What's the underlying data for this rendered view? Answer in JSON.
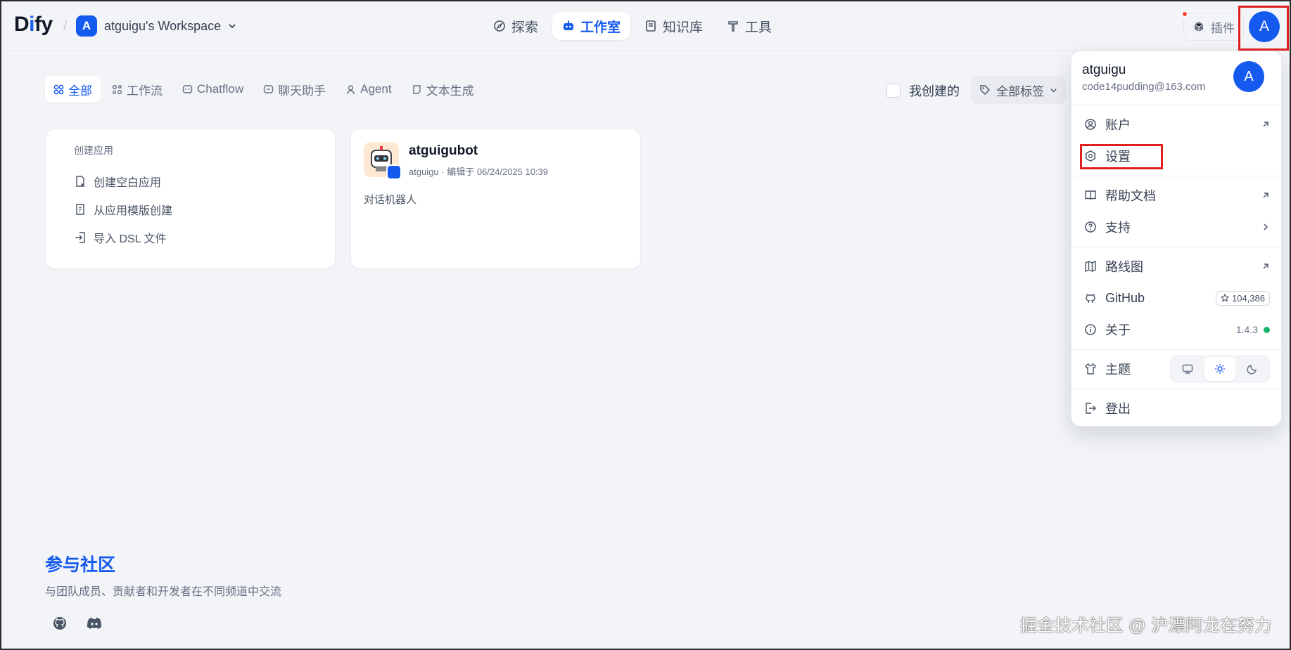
{
  "header": {
    "logo": {
      "d": "D",
      "i": "i",
      "fy": "fy"
    },
    "workspace": {
      "avatar": "A",
      "name": "atguigu's Workspace"
    },
    "nav": [
      {
        "label": "探索",
        "icon": "compass-icon"
      },
      {
        "label": "工作室",
        "icon": "robot-icon",
        "active": true
      },
      {
        "label": "知识库",
        "icon": "book-icon"
      },
      {
        "label": "工具",
        "icon": "hammer-icon"
      }
    ],
    "plugin_label": "插件",
    "user_avatar": "A"
  },
  "filters": {
    "tabs": [
      {
        "label": "全部",
        "active": true
      },
      {
        "label": "工作流"
      },
      {
        "label": "Chatflow"
      },
      {
        "label": "聊天助手"
      },
      {
        "label": "Agent"
      },
      {
        "label": "文本生成"
      }
    ],
    "mine_label": "我创建的",
    "tags_label": "全部标签"
  },
  "create_card": {
    "title": "创建应用",
    "items": [
      "创建空白应用",
      "从应用模版创建",
      "导入 DSL 文件"
    ]
  },
  "app_card": {
    "name": "atguigubot",
    "meta": "atguigu · 编辑于 06/24/2025 10:39",
    "description": "对话机器人"
  },
  "community": {
    "title": "参与社区",
    "subtitle": "与团队成员、贡献者和开发者在不同频道中交流"
  },
  "watermark": "掘金技术社区 @ 沪漂阿龙在努力",
  "menu": {
    "name": "atguigu",
    "email": "code14pudding@163.com",
    "avatar": "A",
    "items": {
      "account": "账户",
      "settings": "设置",
      "help": "帮助文档",
      "support": "支持",
      "roadmap": "路线图",
      "github": "GitHub",
      "github_stars": "104,386",
      "about": "关于",
      "version": "1.4.3",
      "theme": "主题",
      "logout": "登出"
    }
  },
  "colors": {
    "accent": "#155aef",
    "highlight": "#e02020",
    "status_green": "#17b26a"
  }
}
